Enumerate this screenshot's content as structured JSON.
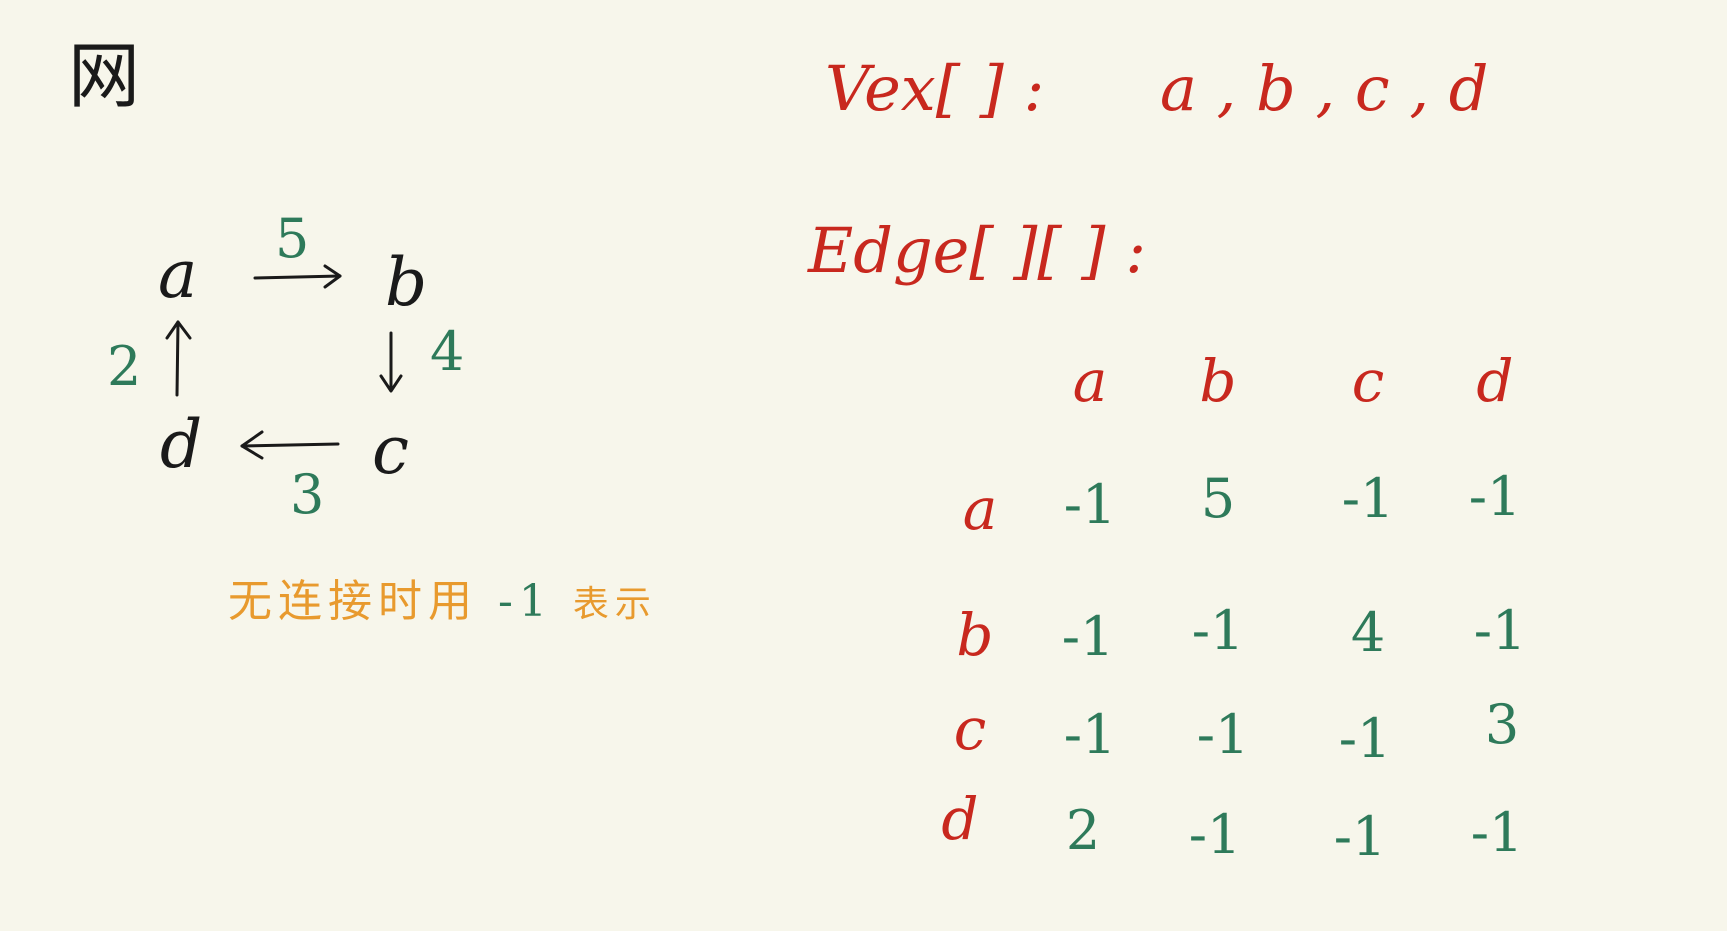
{
  "title": "网",
  "graph": {
    "nodes": [
      "a",
      "b",
      "c",
      "d"
    ],
    "edges": [
      {
        "from": "a",
        "to": "b",
        "weight": "5"
      },
      {
        "from": "b",
        "to": "c",
        "weight": "4"
      },
      {
        "from": "c",
        "to": "d",
        "weight": "3"
      },
      {
        "from": "d",
        "to": "a",
        "weight": "2"
      }
    ]
  },
  "note": {
    "text": "无连接时用",
    "value": "-1",
    "suffix": "表示"
  },
  "vex": {
    "label": "Vex[ ] :",
    "items": "a , b , c , d"
  },
  "edge_matrix": {
    "label": "Edge[ ][ ] :",
    "columns": [
      "a",
      "b",
      "c",
      "d"
    ],
    "rows": [
      {
        "head": "a",
        "cells": [
          "-1",
          "5",
          "-1",
          "-1"
        ]
      },
      {
        "head": "b",
        "cells": [
          "-1",
          "-1",
          "4",
          "-1"
        ]
      },
      {
        "head": "c",
        "cells": [
          "-1",
          "-1",
          "-1",
          "3"
        ]
      },
      {
        "head": "d",
        "cells": [
          "2",
          "-1",
          "-1",
          "-1"
        ]
      }
    ]
  },
  "colors": {
    "background": "#f7f6eb",
    "node_text": "#1a1a1a",
    "weights": "#2e7a5a",
    "labels": "#c8281e",
    "note": "#e89a2e"
  }
}
